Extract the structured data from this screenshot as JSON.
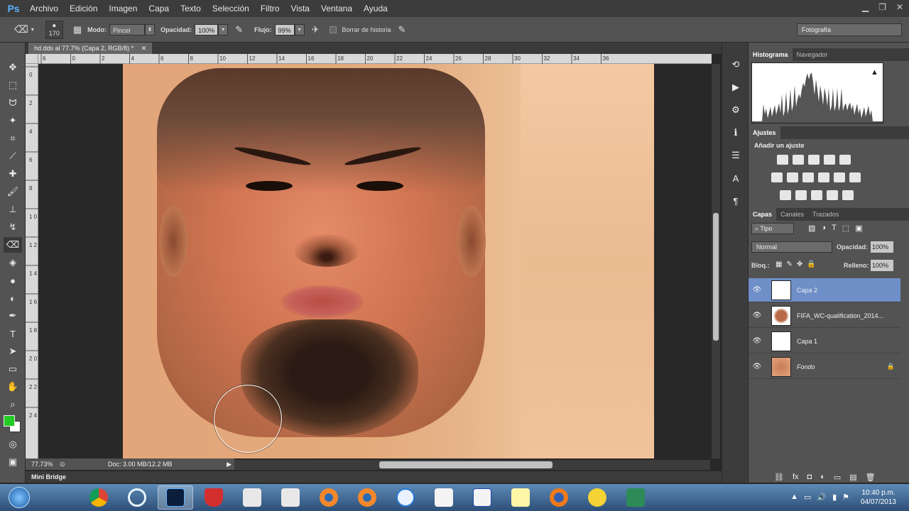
{
  "menubar": {
    "logo": "Ps",
    "items": [
      "Archivo",
      "Edición",
      "Imagen",
      "Capa",
      "Texto",
      "Selección",
      "Filtro",
      "Vista",
      "Ventana",
      "Ayuda"
    ]
  },
  "options": {
    "brush_size": "170",
    "mode_label": "Modo:",
    "mode_value": "Pincel",
    "opacity_label": "Opacidad:",
    "opacity_value": "100%",
    "flow_label": "Flujo:",
    "flow_value": "99%",
    "erase_history_label": "Borrar de historia",
    "workspace": "Fotografía"
  },
  "document": {
    "tab_title": "hd.dds al 77.7% (Capa 2, RGB/8) *",
    "ruler_h": [
      "6",
      "0",
      "2",
      "4",
      "6",
      "8",
      "10",
      "12",
      "14",
      "16",
      "18",
      "20",
      "22",
      "24",
      "26",
      "28",
      "30",
      "32",
      "34",
      "36"
    ],
    "ruler_v": [
      "0",
      "2",
      "4",
      "6",
      "8",
      "1 0",
      "1 2",
      "1 4",
      "1 6",
      "1 8",
      "2 0",
      "2 2",
      "2 4"
    ],
    "zoom": "77.73%",
    "doc_info": "Doc: 3.00 MB/12.2 MB"
  },
  "minibridge": "Mini Bridge",
  "panels": {
    "histogram_tabs": [
      "Histograma",
      "Navegador"
    ],
    "adjust_tab": "Ajustes",
    "adjust_add": "Añadir un ajuste",
    "layers_tabs": [
      "Capas",
      "Canales",
      "Trazados"
    ],
    "kind_filter": "Tipo",
    "blend_mode": "Normal",
    "opacity_label": "Opacidad:",
    "opacity_value": "100%",
    "lock_label": "Bloq.:",
    "fill_label": "Relleno:",
    "fill_value": "100%",
    "layers": [
      {
        "name": "Capa 2",
        "selected": true
      },
      {
        "name": "FIFA_WC-qualification_2014...",
        "selected": false
      },
      {
        "name": "Capa 1",
        "selected": false
      },
      {
        "name": "Fondo",
        "selected": false,
        "locked": true
      }
    ]
  },
  "taskbar": {
    "time": "10:40 p.m.",
    "date": "04/07/2013"
  },
  "colors": {
    "foreground": "#22cc22",
    "background": "#ffffff",
    "selected_layer": "#6f8fc8"
  }
}
